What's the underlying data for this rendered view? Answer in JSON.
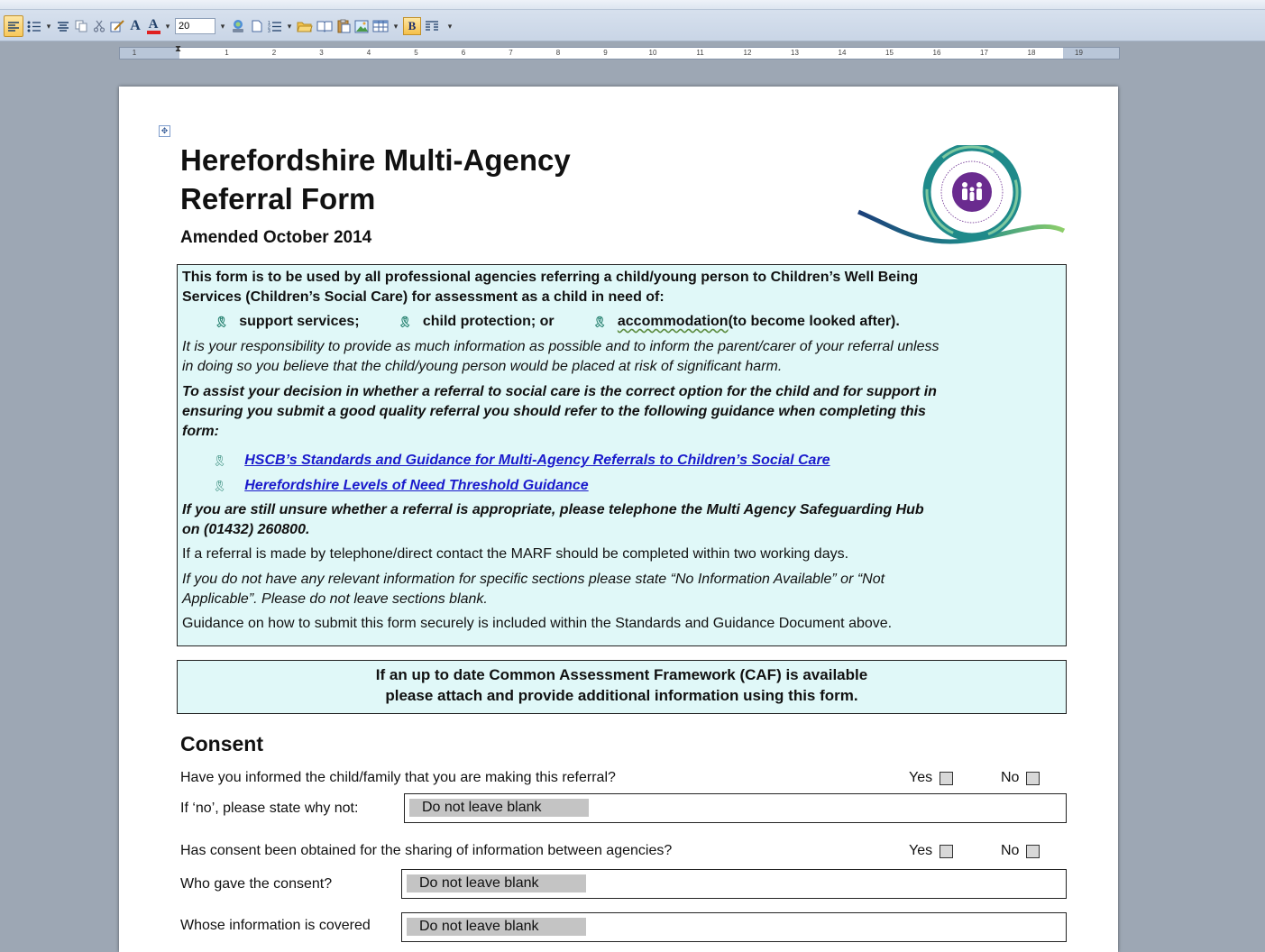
{
  "toolbar": {
    "font_size": "20",
    "bold_label": "B",
    "items": [
      "align-left",
      "bullets",
      "align-center",
      "copy",
      "cut",
      "format-painter",
      "grow-font",
      "font-color",
      "font-size",
      "find",
      "new-page",
      "numbering",
      "open",
      "reading",
      "paste",
      "picture",
      "table",
      "bold",
      "columns",
      "more"
    ]
  },
  "ruler": {
    "ticks": [
      "1",
      "1",
      "2",
      "3",
      "4",
      "5",
      "6",
      "7",
      "8",
      "9",
      "10",
      "11",
      "12",
      "13",
      "14",
      "15",
      "16",
      "17",
      "18",
      "19"
    ]
  },
  "document": {
    "title_line1": "Herefordshire Multi-Agency",
    "title_line2": "Referral Form",
    "subtitle": "Amended October 2014",
    "intro": {
      "line1": "This form is to be used by all professional agencies referring a child/young person to Children’s Well Being",
      "line2": "Services (Children’s Social Care) for assessment  as a child in need of:",
      "bullet1": "support services;",
      "bullet2": "child protection; or",
      "bullet3_word": "accommodation",
      "bullet3_rest": " (to become looked after).",
      "resp1": "It is your responsibility to provide as much information as possible and to inform the parent/carer of your referral unless",
      "resp2": "in doing so you believe that the child/young person would be placed at risk of significant harm.",
      "assist1": "To assist your decision in whether a referral to social care is the correct option for the child and for support in",
      "assist2": "ensuring you submit a good quality referral you should refer to the following guidance when completing this",
      "assist3": "form:",
      "link1": "HSCB’s  Standards  and Guidance for Multi-Agency Referrals  to Children’s Social Care",
      "link2": "Herefordshire  Levels of Need Threshold Guidance",
      "unsure1": "If you are still unsure whether a referral is appropriate,  please telephone the Multi Agency Safeguarding Hub",
      "unsure2": "on (01432)  260800.",
      "phone": "If a referral is made by telephone/direct contact the MARF  should be completed within two working days.",
      "noinfo1": "If you do not have any relevant information for specific sections please state “No Information Available” or “Not",
      "noinfo2": "Applicable”.  Please do not leave sections blank.",
      "submit": "Guidance  on how to submit this form securely is included within the Standards and Guidance  Document above."
    },
    "caf_line1": "If an up to date Common Assessment Framework (CAF) is available",
    "caf_line2": "please attach and provide additional information using this form.",
    "consent": {
      "heading": "Consent",
      "q1": "Have you informed the child/family that you are making this referral?",
      "q1_why": "If ‘no’, please state why not:",
      "q2": "Has consent been obtained for the sharing of information between agencies?",
      "q3": "Who gave the consent?",
      "q4": "Whose information is covered",
      "yes": "Yes",
      "no": "No",
      "placeholder": "Do not leave blank"
    }
  },
  "colors": {
    "info_box_bg": "#e0f8f8",
    "link": "#1a1acc",
    "bullet": "#1f7d6b",
    "logo_purple": "#6a2b8f",
    "logo_teal": "#1f8a8a"
  }
}
